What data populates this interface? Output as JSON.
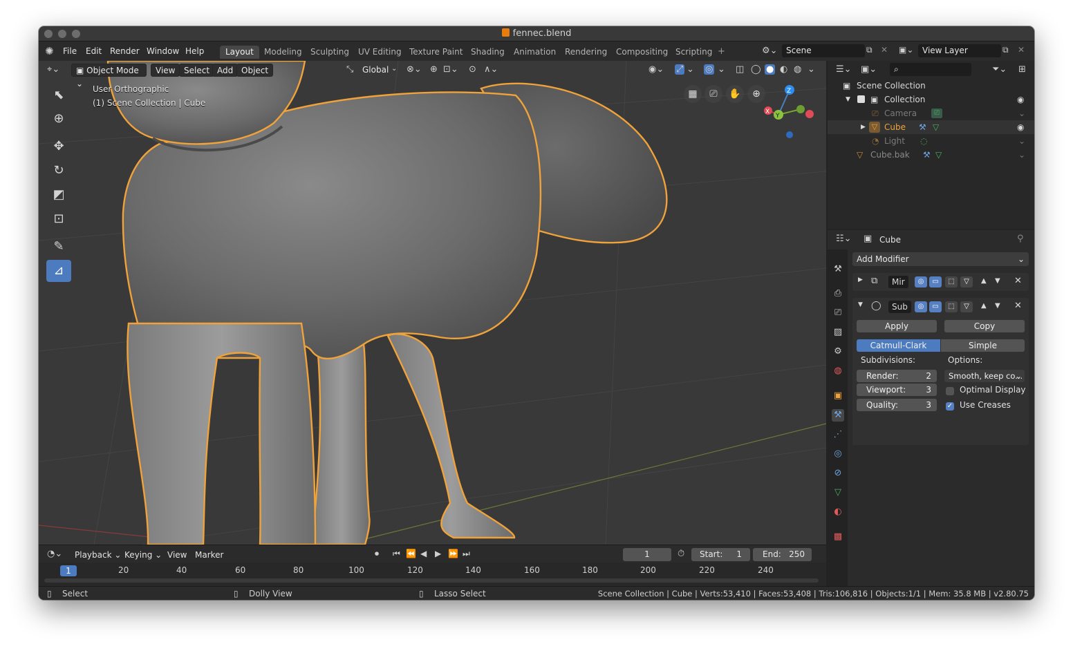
{
  "window": {
    "title": "fennec.blend"
  },
  "menu": [
    "File",
    "Edit",
    "Render",
    "Window",
    "Help"
  ],
  "workspaces": [
    "Layout",
    "Modeling",
    "Sculpting",
    "UV Editing",
    "Texture Paint",
    "Shading",
    "Animation",
    "Rendering",
    "Compositing",
    "Scripting"
  ],
  "active_workspace": "Layout",
  "scene": {
    "name": "Scene",
    "view_layer": "View Layer"
  },
  "viewport": {
    "mode": "Object Mode",
    "header_menus": [
      "View",
      "Select",
      "Add",
      "Object"
    ],
    "orientation": "Global",
    "overlay_view": "User Orthographic",
    "overlay_context": "(1) Scene Collection | Cube",
    "gizmo_axes": {
      "x": "X",
      "y": "Y",
      "z": "Z"
    }
  },
  "outliner": {
    "root": "Scene Collection",
    "items": [
      {
        "label": "Collection",
        "color": "#e6e6e6"
      },
      {
        "label": "Camera",
        "color": "#7a7a7a"
      },
      {
        "label": "Cube",
        "color": "#f0a23b"
      },
      {
        "label": "Light",
        "color": "#7a7a7a"
      },
      {
        "label": "Cube.bak",
        "color": "#8a8a8a"
      }
    ]
  },
  "properties": {
    "object_name": "Cube",
    "add_modifier": "Add Modifier",
    "modifiers": [
      {
        "name": "Mir",
        "expanded": false
      },
      {
        "name": "Sub",
        "expanded": true
      }
    ],
    "apply_label": "Apply",
    "copy_label": "Copy",
    "types": [
      "Catmull-Clark",
      "Simple"
    ],
    "subdivisions_label": "Subdivisions:",
    "options_label": "Options:",
    "render": {
      "label": "Render:",
      "value": "2"
    },
    "viewport_levels": {
      "label": "Viewport:",
      "value": "3"
    },
    "quality": {
      "label": "Quality:",
      "value": "3"
    },
    "uv_smooth": "Smooth, keep co...",
    "optimal_display": {
      "label": "Optimal Display",
      "checked": false
    },
    "use_creases": {
      "label": "Use Creases",
      "checked": true
    }
  },
  "timeline": {
    "menus": [
      "Playback",
      "Keying",
      "View",
      "Marker"
    ],
    "current_frame": "1",
    "start_label": "Start:",
    "start": "1",
    "end_label": "End:",
    "end": "250",
    "ruler": [
      "20",
      "40",
      "60",
      "80",
      "100",
      "120",
      "140",
      "160",
      "180",
      "200",
      "220",
      "240"
    ]
  },
  "status": {
    "left": "Select",
    "middle": "Dolly View",
    "right": "Lasso Select",
    "stats": "Scene Collection | Cube | Verts:53,410 | Faces:53,408 | Tris:106,816 | Objects:1/1 | Mem: 35.8 MB | v2.80.75"
  },
  "colors": {
    "accent": "#4d7bbf",
    "selection": "#f0a23b",
    "viewport_bg": "#393939"
  }
}
